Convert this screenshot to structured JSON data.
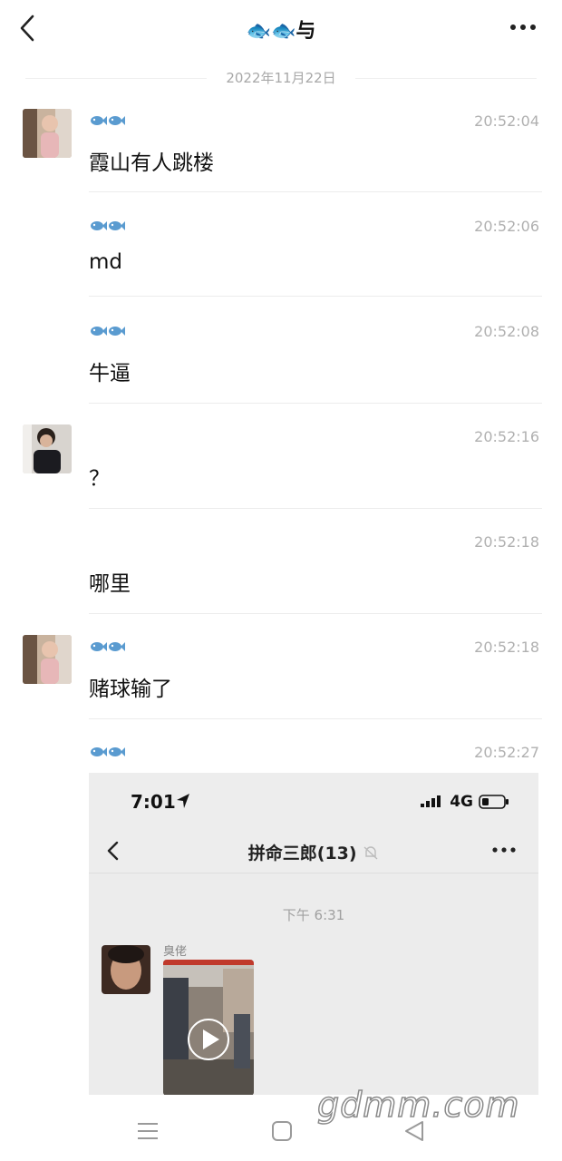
{
  "header": {
    "title": "🐟🐟与"
  },
  "date_separator": "2022年11月22日",
  "messages": [
    {
      "sender": "🐟🐟",
      "time": "20:52:04",
      "text": "霞山有人跳楼"
    },
    {
      "sender": "🐟🐟",
      "time": "20:52:06",
      "text": "md"
    },
    {
      "sender": "🐟🐟",
      "time": "20:52:08",
      "text": "牛逼"
    },
    {
      "sender": "",
      "time": "20:52:16",
      "text": "？"
    },
    {
      "sender": "",
      "time": "20:52:18",
      "text": "哪里"
    },
    {
      "sender": "🐟🐟",
      "time": "20:52:18",
      "text": "赌球输了"
    },
    {
      "sender": "🐟🐟",
      "time": "20:52:27",
      "text": ""
    }
  ],
  "screenshot": {
    "clock": "7:01",
    "network": "4G",
    "group_title": "拼命三郎(13)",
    "timestamp": "下午 6:31",
    "sender_name": "臭佬"
  },
  "watermark": "gdmm.com",
  "colors": {
    "divider": "#ececec",
    "time_text": "#b0b0b0",
    "fish_icon": "#5a9bd0"
  }
}
